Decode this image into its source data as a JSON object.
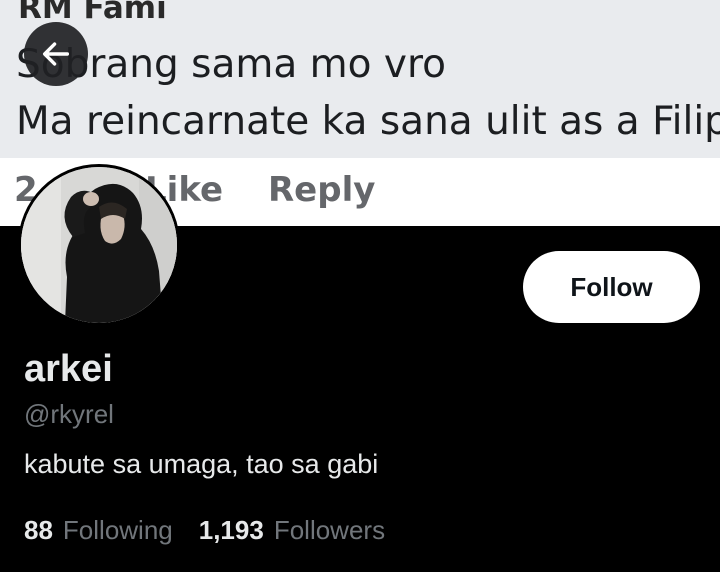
{
  "banner": {
    "comment_author": "RM Fami",
    "comment_lines": [
      "Sobrang sama mo vro",
      "Ma reincarnate ka sana ulit as a Filip"
    ],
    "actions": {
      "time": "2",
      "like": "Like",
      "reply": "Reply"
    }
  },
  "header": {
    "back_icon": "arrow-left-icon"
  },
  "profile": {
    "display_name": "arkei",
    "handle": "@rkyrel",
    "bio": "kabute sa umaga, tao sa gabi",
    "follow_label": "Follow",
    "following_count": "88",
    "following_label": "Following",
    "followers_count": "1,193",
    "followers_label": "Followers"
  }
}
